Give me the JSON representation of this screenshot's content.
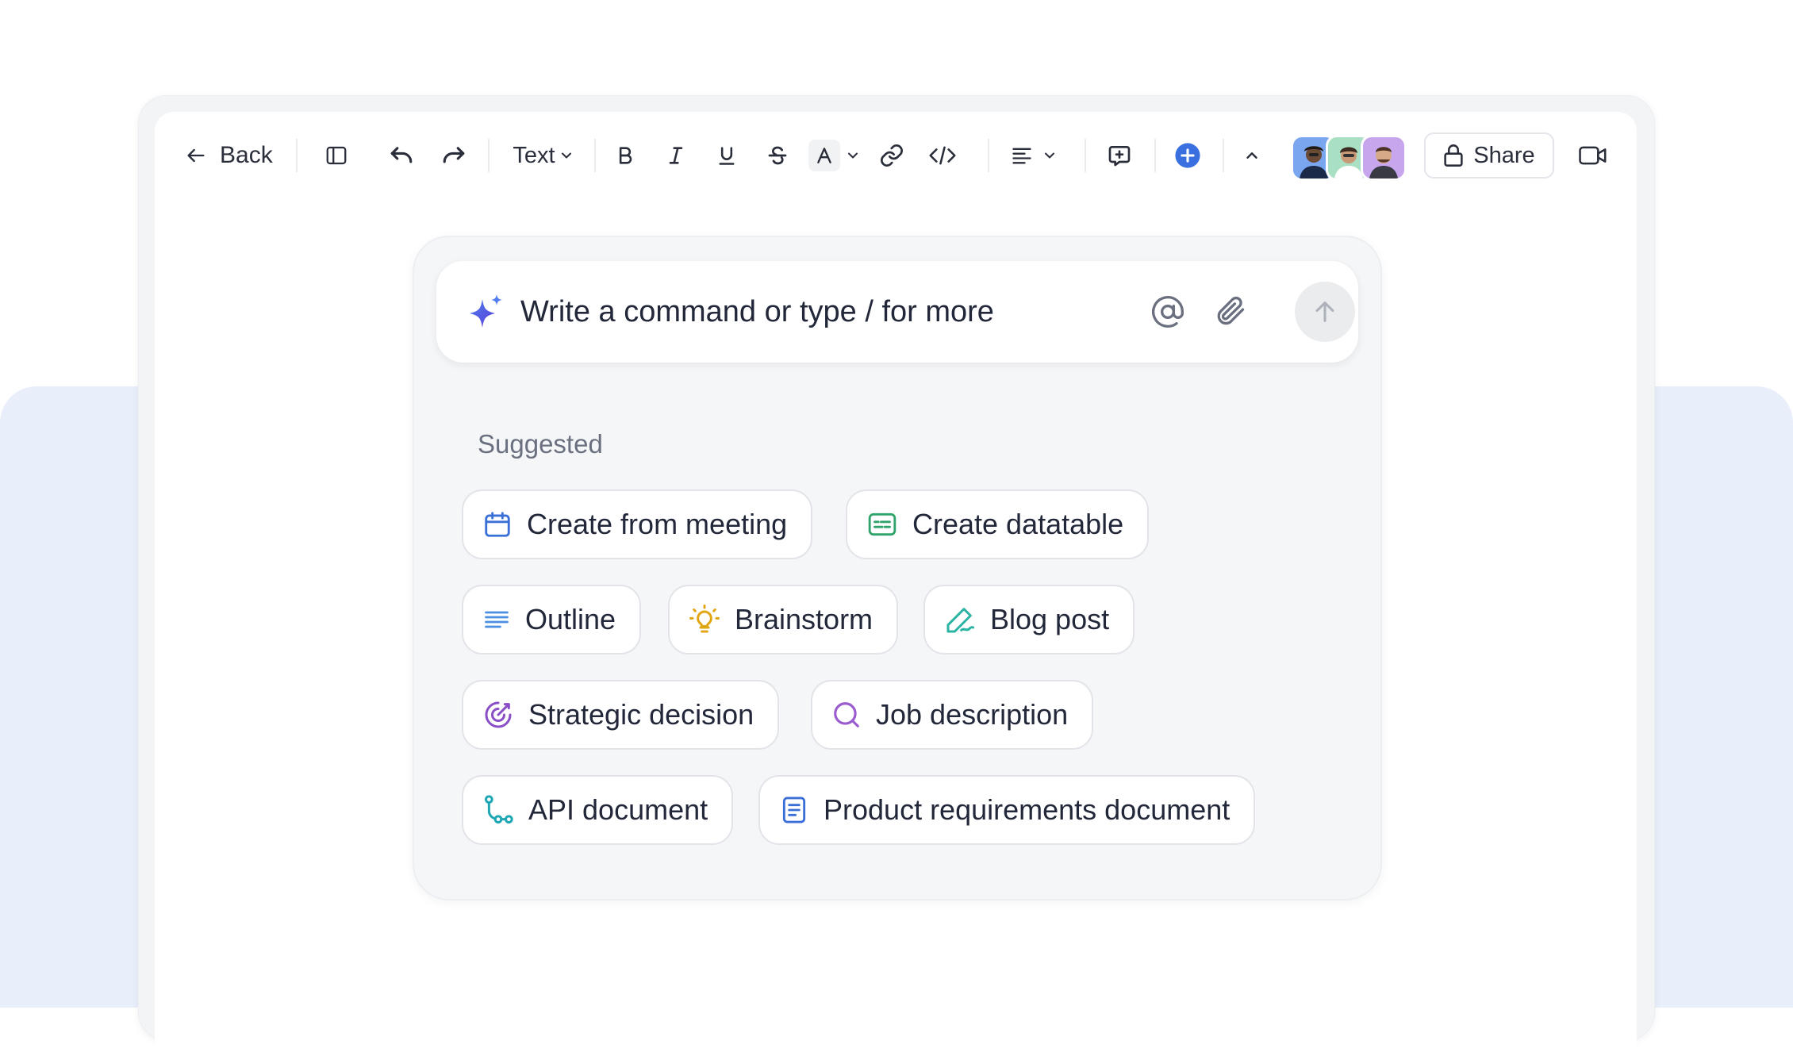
{
  "toolbar": {
    "back_label": "Back",
    "text_style_label": "Text",
    "share_label": "Share"
  },
  "ai_panel": {
    "command_placeholder": "Write a command or type / for more",
    "suggested_label": "Suggested",
    "suggestions": [
      {
        "label": "Create from meeting",
        "icon": "calendar-icon",
        "color": "#3b6fd8"
      },
      {
        "label": "Create datatable",
        "icon": "datatable-icon",
        "color": "#2fa36b"
      },
      {
        "label": "Outline",
        "icon": "outline-icon",
        "color": "#4a8fe0"
      },
      {
        "label": "Brainstorm",
        "icon": "lightbulb-icon",
        "color": "#e0a613"
      },
      {
        "label": "Blog post",
        "icon": "pen-icon",
        "color": "#2bb3a3"
      },
      {
        "label": "Strategic decision",
        "icon": "target-icon",
        "color": "#8a4fc7"
      },
      {
        "label": "Job description",
        "icon": "search-icon",
        "color": "#9a5ccf"
      },
      {
        "label": "API document",
        "icon": "flow-icon",
        "color": "#1ea7b5"
      },
      {
        "label": "Product requirements document",
        "icon": "document-icon",
        "color": "#3b6fd8"
      }
    ]
  },
  "colors": {
    "accent_blue": "#3a6fe0",
    "backdrop": "#e8eefa"
  }
}
